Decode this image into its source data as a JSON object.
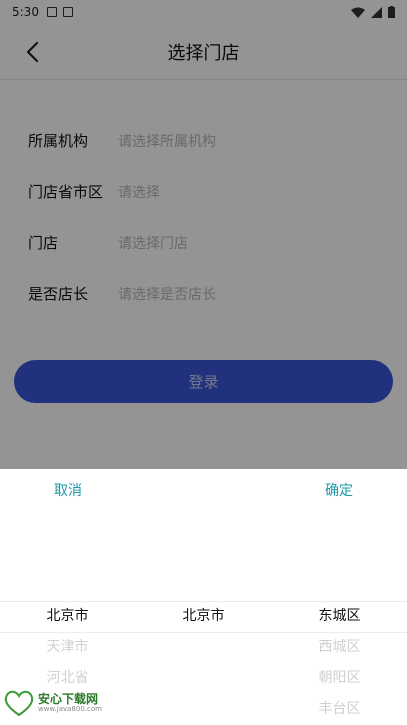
{
  "status_bar": {
    "time": "5:30"
  },
  "header": {
    "title": "选择门店"
  },
  "form": {
    "rows": [
      {
        "label": "所属机构",
        "placeholder": "请选择所属机构"
      },
      {
        "label": "门店省市区",
        "placeholder": "请选择"
      },
      {
        "label": "门店",
        "placeholder": "请选择门店"
      },
      {
        "label": "是否店长",
        "placeholder": "请选择是否店长"
      }
    ],
    "login_label": "登录"
  },
  "picker": {
    "cancel_label": "取消",
    "confirm_label": "确定",
    "accent": "#1a9aa8",
    "province": [
      "北京市",
      "天津市",
      "河北省"
    ],
    "city": [
      "北京市"
    ],
    "district": [
      "东城区",
      "西城区",
      "朝阳区",
      "丰台区"
    ]
  },
  "watermark": {
    "brand": "安心下载网",
    "url": "www.java800.com"
  }
}
